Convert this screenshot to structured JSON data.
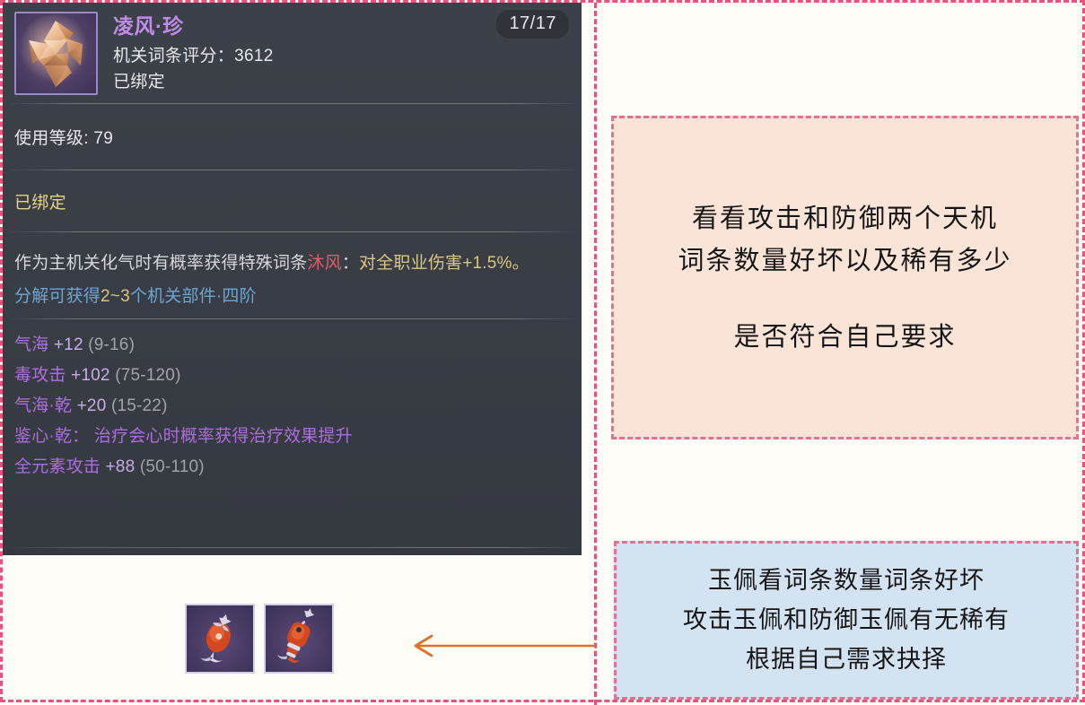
{
  "tooltip": {
    "item_icon_name": "polyhedron-star-item-icon",
    "item_name": "凌风·珍",
    "score_label": "机关词条评分：3612",
    "bound_head": "已绑定",
    "durability": "17/17",
    "level_label": "使用等级: 79",
    "bound_status": "已绑定",
    "description": {
      "seg1": "作为主机关化气时有概率获得特殊词条",
      "seg2_highlight": "沐风",
      "seg3": "：",
      "seg4_gold": "对全职业伤害+1.5%。"
    },
    "decompose": {
      "prefix": "分解可获得",
      "amount": "2~3",
      "suffix": "个机关部件·四阶"
    },
    "stats": [
      {
        "name": "气海",
        "value": "+12",
        "range": "(9-16)"
      },
      {
        "name": "毒攻击",
        "value": "+102",
        "range": "(75-120)"
      },
      {
        "name": "气海·乾",
        "value": "+20",
        "range": "(15-22)"
      },
      {
        "name": "鉴心·乾：",
        "value": "治疗会心时概率获得治疗效果提升",
        "range": ""
      },
      {
        "name": "全元素攻击",
        "value": "+88",
        "range": "(50-110)"
      }
    ]
  },
  "thumbnails": [
    {
      "name": "attack-jade-pendant-icon"
    },
    {
      "name": "defense-jade-pendant-icon"
    }
  ],
  "annotations": {
    "top_note": {
      "lines": [
        "看看攻击和防御两个天机",
        "词条数量好坏以及稀有多少"
      ],
      "line3": "是否符合自己要求"
    },
    "bottom_note": {
      "lines": [
        "玉佩看词条数量词条好坏",
        "攻击玉佩和防御玉佩有无稀有",
        "根据自己需求抉择"
      ]
    },
    "arrow": {
      "name": "pointer-arrow-left"
    }
  },
  "colors": {
    "panel_bg": "#383c44",
    "item_name": "#c08ae8",
    "bound": "#e8d98a",
    "highlight_red": "#e4606a",
    "gold": "#e0cb86",
    "blue": "#6fa9d8",
    "stat_purple": "#b472e8",
    "note_top_bg": "#fae4d7",
    "note_bottom_bg": "#d4e3f2",
    "dashed_border": "#e8527f",
    "arrow": "#e2722a"
  }
}
